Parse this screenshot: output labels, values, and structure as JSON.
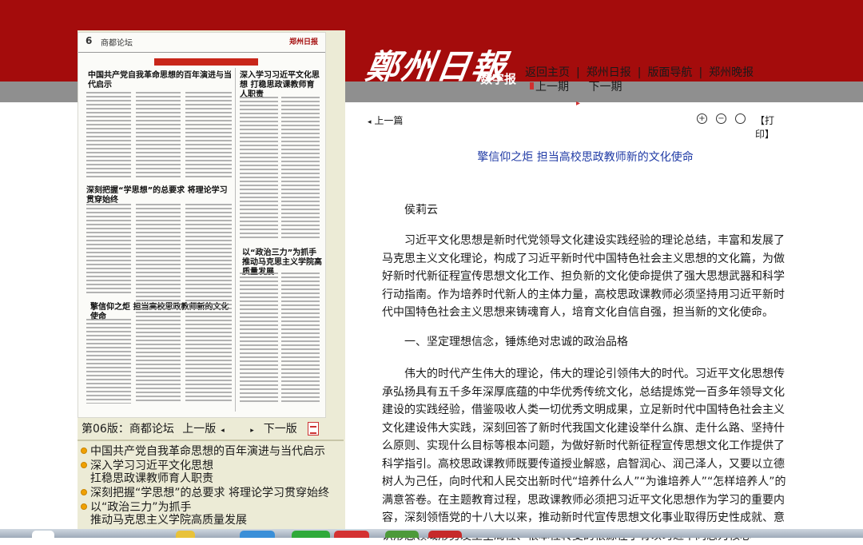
{
  "colors": {
    "header_red": "#a40c0c",
    "grey_band": "#8f8f8f",
    "side_panel": "#ecebd6",
    "title_blue": "#1f3aa5",
    "bullet_orange": "#f0a000"
  },
  "header": {
    "logo": "鄭州日報",
    "logo_sub": "数字报",
    "nav": [
      "返回主页",
      "郑州日报",
      "版面导航",
      "郑州晚报"
    ],
    "prev_period": "上一期",
    "next_period": "下一期"
  },
  "page_thumb": {
    "page_no": "6",
    "page_name": "商都论坛",
    "masthead": "郑州日报",
    "headlines": [
      "中国共产党自我革命思想的百年演进与当代启示",
      "深入学习习近平文化思想 打稳思政课教师育人职责",
      "深刻把握“学思想”的总要求 将理论学习贯穿始终",
      "以“政治三力”为抓手 推动马克思主义学院高质量发展",
      "擎信仰之炬 担当高校思政教师新的文化使命"
    ]
  },
  "page_nav": {
    "label": "第06版：商都论坛",
    "prev": "上一版",
    "next": "下一版",
    "pdf_icon": "pdf-icon"
  },
  "toc": [
    "中国共产党自我革命思想的百年演进与当代启示",
    "深入学习习近平文化思想\n扛稳思政课教师育人职责",
    "深刻把握“学思想”的总要求 将理论学习贯穿始终",
    "以“政治三力”为抓手\n推动马克思主义学院高质量发展"
  ],
  "article_bar": {
    "prev": "上一篇",
    "tools": [
      "zoom-in-icon",
      "zoom-out-icon",
      "reset-icon"
    ],
    "print": "【打印】"
  },
  "article": {
    "title": "擎信仰之炬 担当高校思政教师新的文化使命",
    "author": "侯莉云",
    "paragraphs": [
      "习近平文化思想是新时代党领导文化建设实践经验的理论总结，丰富和发展了马克思主义文化理论，构成了习近平新时代中国特色社会主义思想的文化篇，为做好新时代新征程宣传思想文化工作、担负新的文化使命提供了强大思想武器和科学行动指南。作为培养时代新人的主体力量，高校思政课教师必须坚持用习近平新时代中国特色社会主义思想来铸魂育人，培育文化自信自强，担当新的文化使命。",
      "一、坚定理想信念，锤炼绝对忠诚的政治品格",
      "伟大的时代产生伟大的理论，伟大的理论引领伟大的时代。习近平文化思想传承弘扬具有五千多年深厚底蕴的中华优秀传统文化，总结提炼党一百多年领导文化建设的实践经验，借鉴吸收人类一切优秀文明成果，立足新时代中国特色社会主义文化建设伟大实践，深刻回答了新时代我国文化建设举什么旗、走什么路、坚持什么原则、实现什么目标等根本问题，为做好新时代新征程宣传思想文化工作提供了科学指引。高校思政课教师既要传道授业解惑，启智润心、润己泽人，又要以立德树人为己任，向时代和人民交出新时代“培养什么人”“为谁培养人”“怎样培养人”的满意答卷。在主题教育过程，思政课教师必须把习近平文化思想作为学习的重要内容，深刻领悟党的十八大以来，推动新时代宣传思想文化事业取得历史性成就、意识形态领域形势发生全局性、根本性转变的根源在于有以习近平同志为核心"
    ]
  }
}
